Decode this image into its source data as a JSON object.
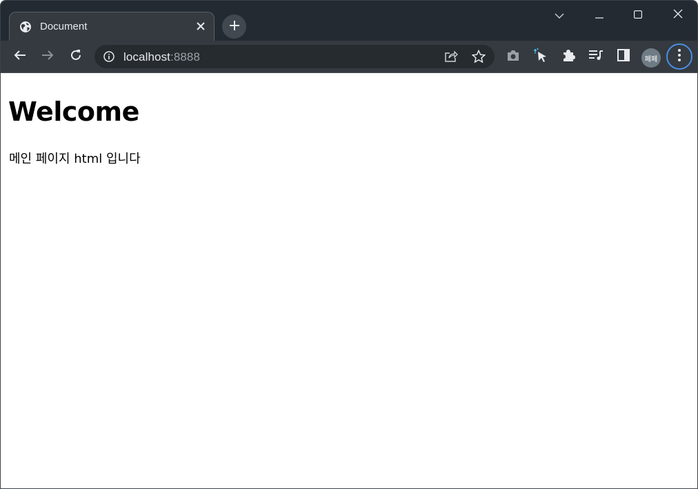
{
  "browser": {
    "tab": {
      "title": "Document",
      "favicon": "globe-icon"
    },
    "new_tab_icon": "plus-icon",
    "window_controls": [
      "tab-search-icon",
      "minimize-icon",
      "maximize-icon",
      "close-icon"
    ],
    "toolbar": {
      "back_icon": "arrow-left-icon",
      "forward_icon": "arrow-right-icon",
      "reload_icon": "reload-icon",
      "omnibox": {
        "host": "localhost",
        "port": ":8888",
        "info_icon": "info-icon",
        "share_icon": "share-icon",
        "bookmark_icon": "star-icon"
      },
      "extensions": [
        "camera-icon",
        "cursor-click-icon",
        "puzzle-icon",
        "media-queue-icon",
        "side-panel-icon"
      ],
      "avatar_text": "페페",
      "menu_icon": "kebab-menu-icon"
    },
    "colors": {
      "frame": "#232a31",
      "toolbar": "#343a40",
      "accent": "#4a90e2"
    }
  },
  "page": {
    "heading": "Welcome",
    "paragraph": "메인 페이지 html 입니다"
  }
}
